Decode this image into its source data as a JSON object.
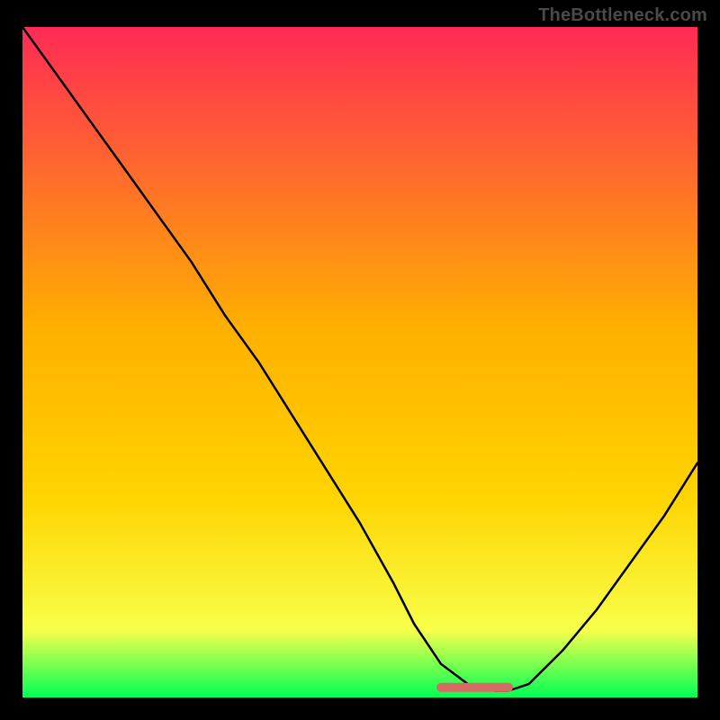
{
  "watermark": "TheBottleneck.com",
  "chart_data": {
    "type": "line",
    "title": "",
    "xlabel": "",
    "ylabel": "",
    "xlim": [
      0,
      100
    ],
    "ylim": [
      0,
      100
    ],
    "series": [
      {
        "name": "curve",
        "x": [
          0,
          5,
          10,
          15,
          20,
          25,
          30,
          35,
          40,
          45,
          50,
          55,
          58,
          62,
          66,
          70,
          72,
          75,
          80,
          85,
          90,
          95,
          100
        ],
        "values": [
          100,
          93,
          86,
          79,
          72,
          65,
          57,
          50,
          42,
          34,
          26,
          17,
          11,
          5,
          2,
          1,
          1,
          2,
          7,
          13,
          20,
          27,
          35
        ]
      }
    ],
    "flat_zone": {
      "x_start": 62,
      "x_end": 72,
      "y": 1.5
    },
    "colors": {
      "gradient_top": "#ff2a55",
      "gradient_mid": "#ffd400",
      "gradient_low": "#f7ff4a",
      "gradient_bottom": "#00ff55",
      "curve": "#000000",
      "flat_marker": "#d96a63",
      "frame": "#000000"
    }
  }
}
